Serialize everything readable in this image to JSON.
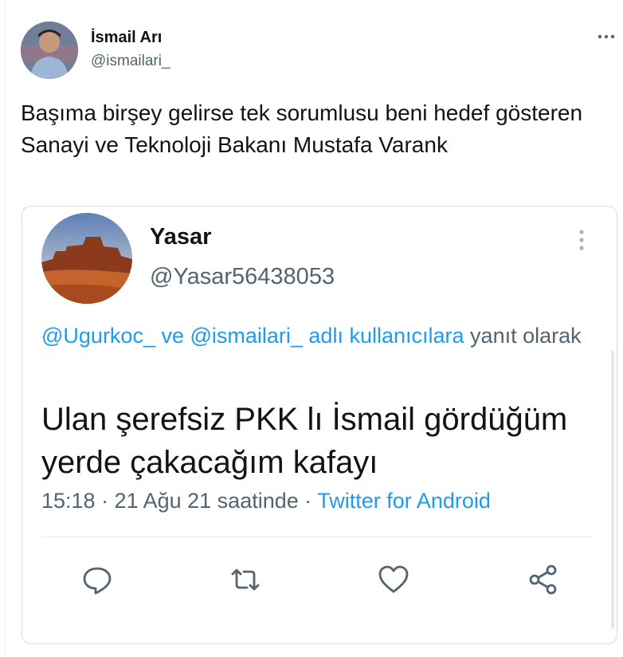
{
  "author": {
    "name": "İsmail Arı",
    "handle": "@ismailari_"
  },
  "tweet": {
    "text": "Başıma birşey gelirse tek sorumlusu beni hedef gösteren Sanayi ve Teknoloji Bakanı Mustafa Varank"
  },
  "quoted": {
    "name": "Yasar",
    "handle": "@Yasar56438053",
    "reply_links": "@Ugurkoc_ ve @ismailari_ adlı kullanıcılara",
    "reply_suffix": "yanıt olarak",
    "body": "Ulan şerefsiz PKK lı İsmail gördüğüm yerde çakacağım kafayı",
    "time_date": "15:18 · 21 Ağu 21 saatinde ·",
    "source": "Twitter for Android",
    "actions": {
      "reply": "comment-icon",
      "retweet": "retweet-icon",
      "like": "heart-icon",
      "share": "share-icon"
    },
    "colors": {
      "link": "#1d9bf0",
      "secondary": "#536471"
    }
  }
}
